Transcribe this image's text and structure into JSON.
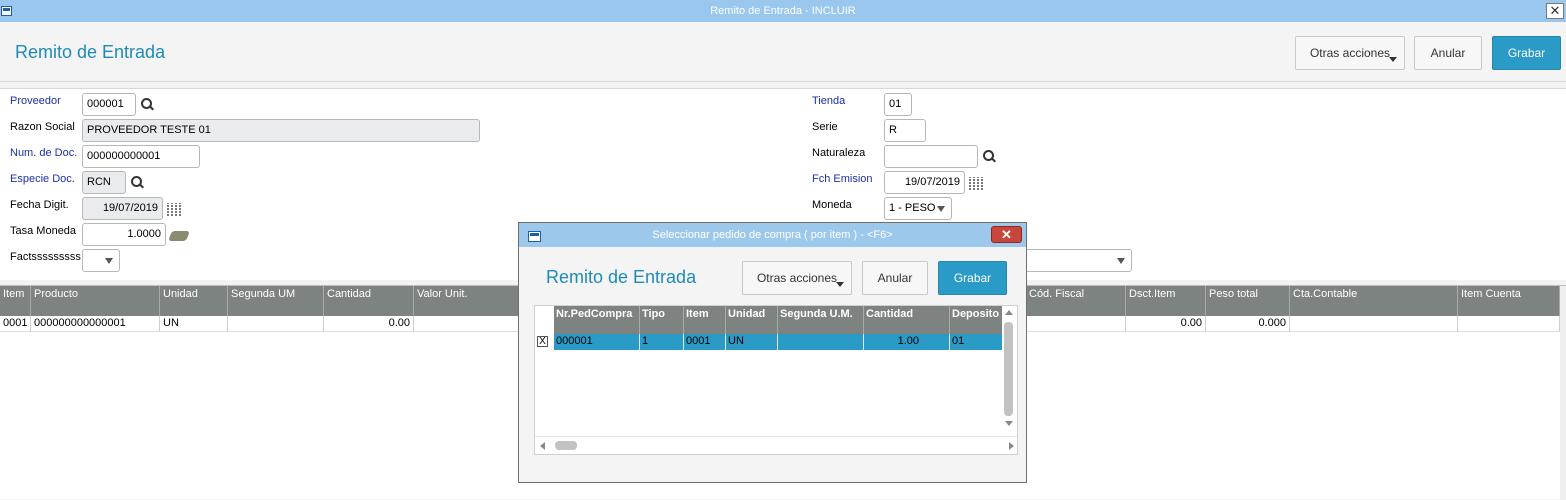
{
  "window": {
    "title": "Remito de Entrada - INCLUIR"
  },
  "header": {
    "page_title": "Remito de Entrada",
    "otras_acciones": "Otras acciones",
    "anular": "Anular",
    "grabar": "Grabar"
  },
  "form": {
    "proveedor": {
      "label": "Proveedor",
      "value": "000001"
    },
    "razon_social": {
      "label": "Razon Social",
      "value": "PROVEEDOR TESTE 01"
    },
    "num_doc": {
      "label": "Num. de Doc.",
      "value": "000000000001"
    },
    "especie_doc": {
      "label": "Especie Doc.",
      "value": "RCN"
    },
    "fecha_digit": {
      "label": "Fecha Digit.",
      "value": "19/07/2019"
    },
    "tasa_moneda": {
      "label": "Tasa Moneda",
      "value": "1.0000"
    },
    "factsssssss": {
      "label": "Factsssssssss",
      "value": ""
    },
    "tienda": {
      "label": "Tienda",
      "value": "01"
    },
    "serie": {
      "label": "Serie",
      "value": "R"
    },
    "naturaleza": {
      "label": "Naturaleza",
      "value": ""
    },
    "fch_emision": {
      "label": "Fch Emision",
      "value": "19/07/2019"
    },
    "moneda": {
      "label": "Moneda",
      "value": "1 - PESO"
    }
  },
  "grid": {
    "columns": [
      "Item",
      "Producto",
      "Unidad",
      "Segunda UM",
      "Cantidad",
      "Valor Unit.",
      "Cód. Fiscal",
      "Dsct.Item",
      "Peso total",
      "Cta.Contable",
      "Item Cuenta"
    ],
    "rows": [
      {
        "item": "0001",
        "producto": "000000000000001",
        "unidad": "UN",
        "segunda_um": "",
        "cantidad": "0.00",
        "valor_unit": "",
        "cod_fiscal": "",
        "dsct_item": "0.00",
        "peso_total": "0.000",
        "cta_contable": "",
        "item_cuenta": ""
      }
    ]
  },
  "dialog": {
    "title": "Seleccionar pedido de compra ( por item ) - <F6>",
    "close": "✕",
    "page_title": "Remito de Entrada",
    "otras_acciones": "Otras acciones",
    "anular": "Anular",
    "grabar": "Grabar",
    "columns": [
      "Nr.PedCompra",
      "Tipo",
      "Item",
      "Unidad",
      "Segunda U.M.",
      "Cantidad",
      "Deposito"
    ],
    "rows": [
      {
        "checked": "X",
        "nr_pedcompra": "000001",
        "tipo": "1",
        "item": "0001",
        "unidad": "UN",
        "segunda_um": "",
        "cantidad": "1.00",
        "deposito": "01"
      }
    ]
  },
  "colors": {
    "accent": "#2a9ac6",
    "title_text": "#1f8bb5",
    "grid_header": "#7c8381",
    "titlebar": "#99c7ee",
    "field_label_blue": "#1c2fa7"
  }
}
